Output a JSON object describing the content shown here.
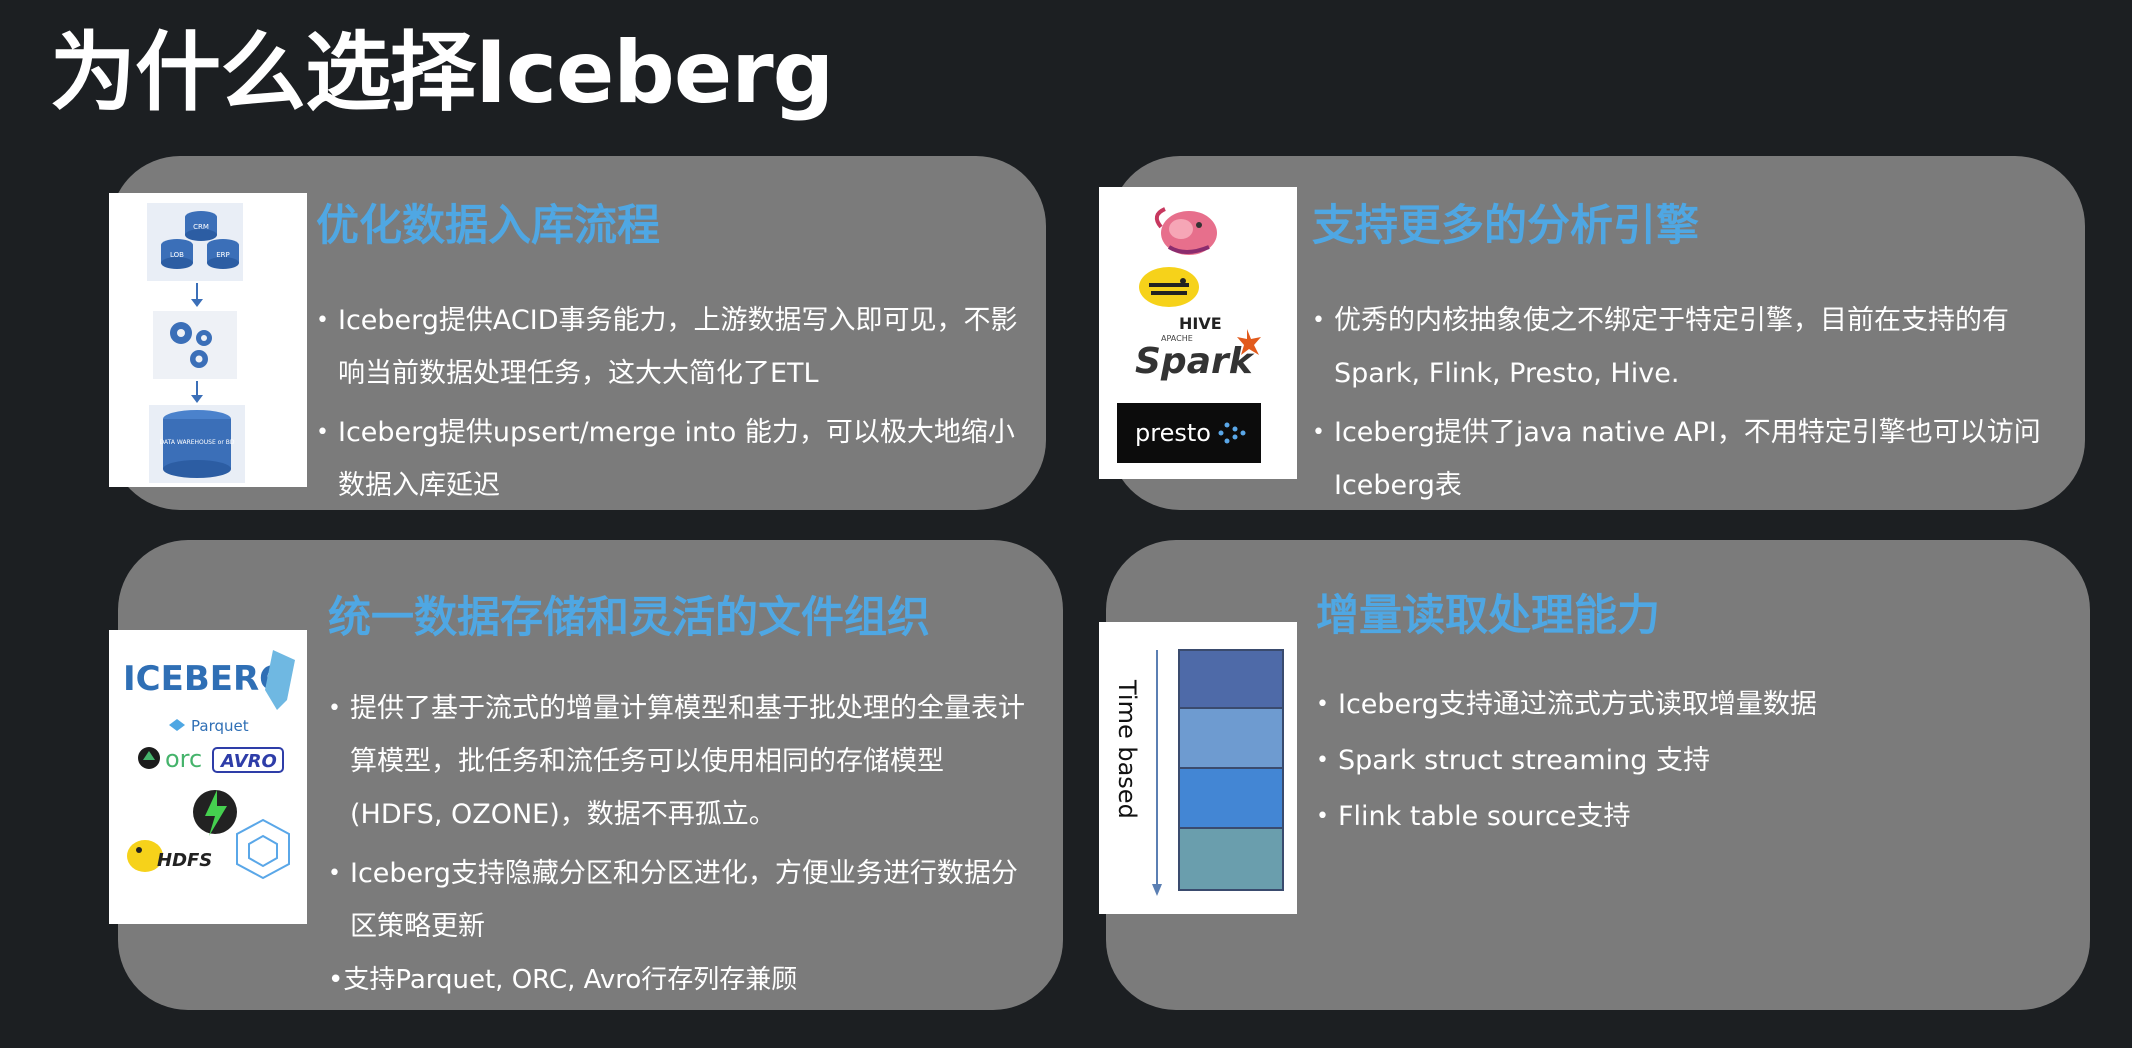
{
  "page": {
    "title": "为什么选择Iceberg"
  },
  "cards": [
    {
      "title": "优化数据入库流程",
      "bullets": [
        "Iceberg提供ACID事务能力，上游数据写入即可见，不影响当前数据处理任务，这大大简化了ETL",
        "Iceberg提供upsert/merge into 能力，可以极大地缩小数据入库延迟"
      ],
      "image": {
        "labels": [
          "CRM",
          "LOB",
          "ERP",
          "DATA WAREHOUSE or BD"
        ]
      }
    },
    {
      "title": "支持更多的分析引擎",
      "bullets": [
        "优秀的内核抽象使之不绑定于特定引擎，目前在支持的有Spark, Flink, Presto, Hive.",
        "Iceberg提供了java native API，不用特定引擎也可以访问Iceberg表"
      ],
      "image": {
        "hive_label": "HIVE",
        "spark_small": "APACHE",
        "spark_label": "Spark",
        "presto_label": "presto"
      }
    },
    {
      "title": "统一数据存储和灵活的文件组织",
      "bullets": [
        "提供了基于流式的增量计算模型和基于批处理的全量表计算模型，批任务和流任务可以使用相同的存储模型(HDFS, OZONE)，数据不再孤立。",
        "Iceberg支持隐藏分区和分区进化，方便业务进行数据分区策略更新"
      ],
      "extra_line": "•支持Parquet, ORC, Avro行存列存兼顾",
      "image": {
        "iceberg_label": "ICEBERG",
        "parquet_label": "Parquet",
        "orc_label": "orc",
        "avro_label": "AVRO",
        "hdfs_label": "HDFS"
      }
    },
    {
      "title": "增量读取处理能力",
      "bullets": [
        "Iceberg支持通过流式方式读取增量数据",
        "Spark struct streaming 支持",
        "Flink table source支持"
      ],
      "image": {
        "axis_label": "Time based",
        "block_colors": [
          "#4e6aa8",
          "#6e9bd0",
          "#4386d4",
          "#6a9ead"
        ]
      }
    }
  ]
}
